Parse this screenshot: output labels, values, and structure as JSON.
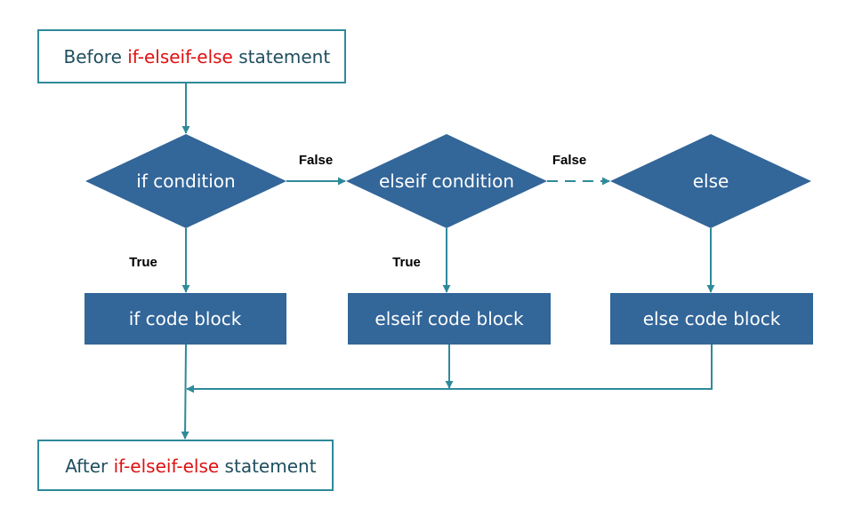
{
  "colors": {
    "shape_fill": "#336699",
    "connector": "#2e8a9a",
    "terminal_border": "#2e8a9a",
    "terminal_text": "#1f4e5f",
    "highlight_text": "#e01010",
    "label_text": "#000000"
  },
  "nodes": {
    "start": {
      "prefix": "Before ",
      "highlight": "if-elseif-else",
      "suffix": " statement"
    },
    "if_condition": {
      "label": "if condition"
    },
    "elseif_condition": {
      "label": "elseif condition"
    },
    "else": {
      "label": "else"
    },
    "if_block": {
      "label": "if code block"
    },
    "elseif_block": {
      "label": "elseif code block"
    },
    "else_block": {
      "label": "else code block"
    },
    "end": {
      "prefix": "After ",
      "highlight": "if-elseif-else",
      "suffix": " statement"
    }
  },
  "edges": {
    "if_false": {
      "label": "False",
      "style": "solid"
    },
    "elseif_false": {
      "label": "False",
      "style": "dashed"
    },
    "if_true": {
      "label": "True"
    },
    "elseif_true": {
      "label": "True"
    }
  }
}
